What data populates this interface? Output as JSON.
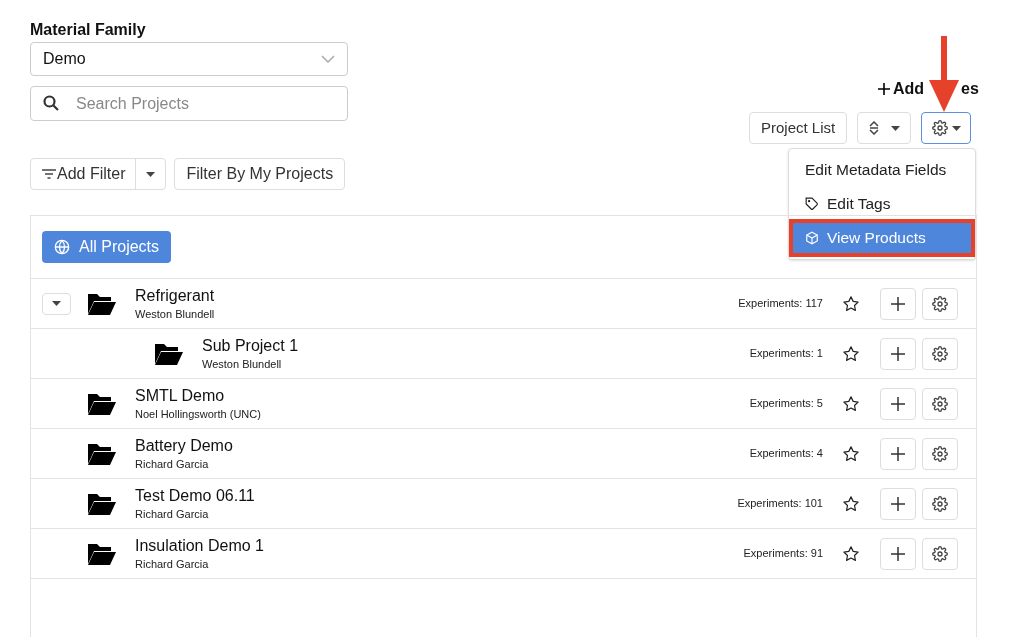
{
  "material_family": {
    "label": "Material Family",
    "value": "Demo"
  },
  "search": {
    "placeholder": "Search Projects"
  },
  "add_button": {
    "label": "Add",
    "label_tail": "es"
  },
  "toolbar": {
    "view_button": "Project List"
  },
  "settings_menu": {
    "expanded": true,
    "items": [
      {
        "label": "Edit Metadata Fields",
        "kind": "plain",
        "selected": false
      },
      {
        "label": "Edit Tags",
        "kind": "tag",
        "selected": false
      },
      {
        "label": "View Products",
        "kind": "box",
        "selected": true
      }
    ]
  },
  "filters": {
    "add_filter": "Add Filter",
    "my_projects": "Filter By My Projects"
  },
  "scope_button": "All Projects",
  "projects": [
    {
      "name": "Refrigerant",
      "owner": "Weston Blundell",
      "experiments": "Experiments: 117",
      "expanded": true,
      "children": [
        {
          "name": "Sub Project 1",
          "owner": "Weston Blundell",
          "experiments": "Experiments: 1"
        }
      ]
    },
    {
      "name": "SMTL Demo",
      "owner": "Noel Hollingsworth (UNC)",
      "experiments": "Experiments: 5"
    },
    {
      "name": "Battery Demo",
      "owner": "Richard Garcia",
      "experiments": "Experiments: 4"
    },
    {
      "name": "Test Demo 06.11",
      "owner": "Richard Garcia",
      "experiments": "Experiments: 101"
    },
    {
      "name": "Insulation Demo 1",
      "owner": "Richard Garcia",
      "experiments": "Experiments: 91"
    }
  ]
}
